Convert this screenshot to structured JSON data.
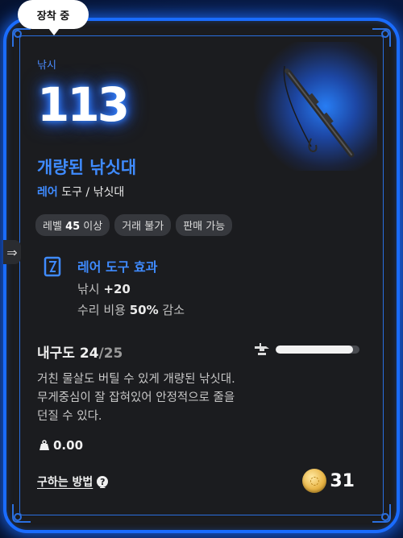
{
  "tag": {
    "label": "장착 중"
  },
  "item": {
    "category": "낚시",
    "power": "113",
    "name": "개량된 낚싯대",
    "grade": "레어",
    "type_rest": " 도구 / 낚싯대"
  },
  "badges": {
    "level_prefix": "레벨 ",
    "level_value": "45",
    "level_suffix": " 이상",
    "trade": "거래 불가",
    "sell": "판매 가능"
  },
  "effect": {
    "title": "레어 도구 효과",
    "line1_label": "낚시 ",
    "line1_value": "+20",
    "line2_label": "수리 비용 ",
    "line2_value": "50%",
    "line2_suffix": " 감소"
  },
  "durability": {
    "label": "내구도 ",
    "current": "24",
    "max": "/25",
    "fraction": 0.92
  },
  "description": {
    "line1": "거친 물살도 버틸 수 있게 개량된 낚싯대.",
    "line2": "무게중심이 잘 잡혀있어 안정적으로 줄을",
    "line3": "던질 수 있다."
  },
  "weight": {
    "value": "0.00",
    "icon": "weight-icon"
  },
  "howto": {
    "label": "구하는 방법",
    "icon": "help-icon"
  },
  "price": {
    "value": "31",
    "icon": "coin-icon"
  },
  "colors": {
    "accent": "#3f8bff",
    "border": "#1a6cff",
    "card_bg": "#1b1c1f"
  }
}
